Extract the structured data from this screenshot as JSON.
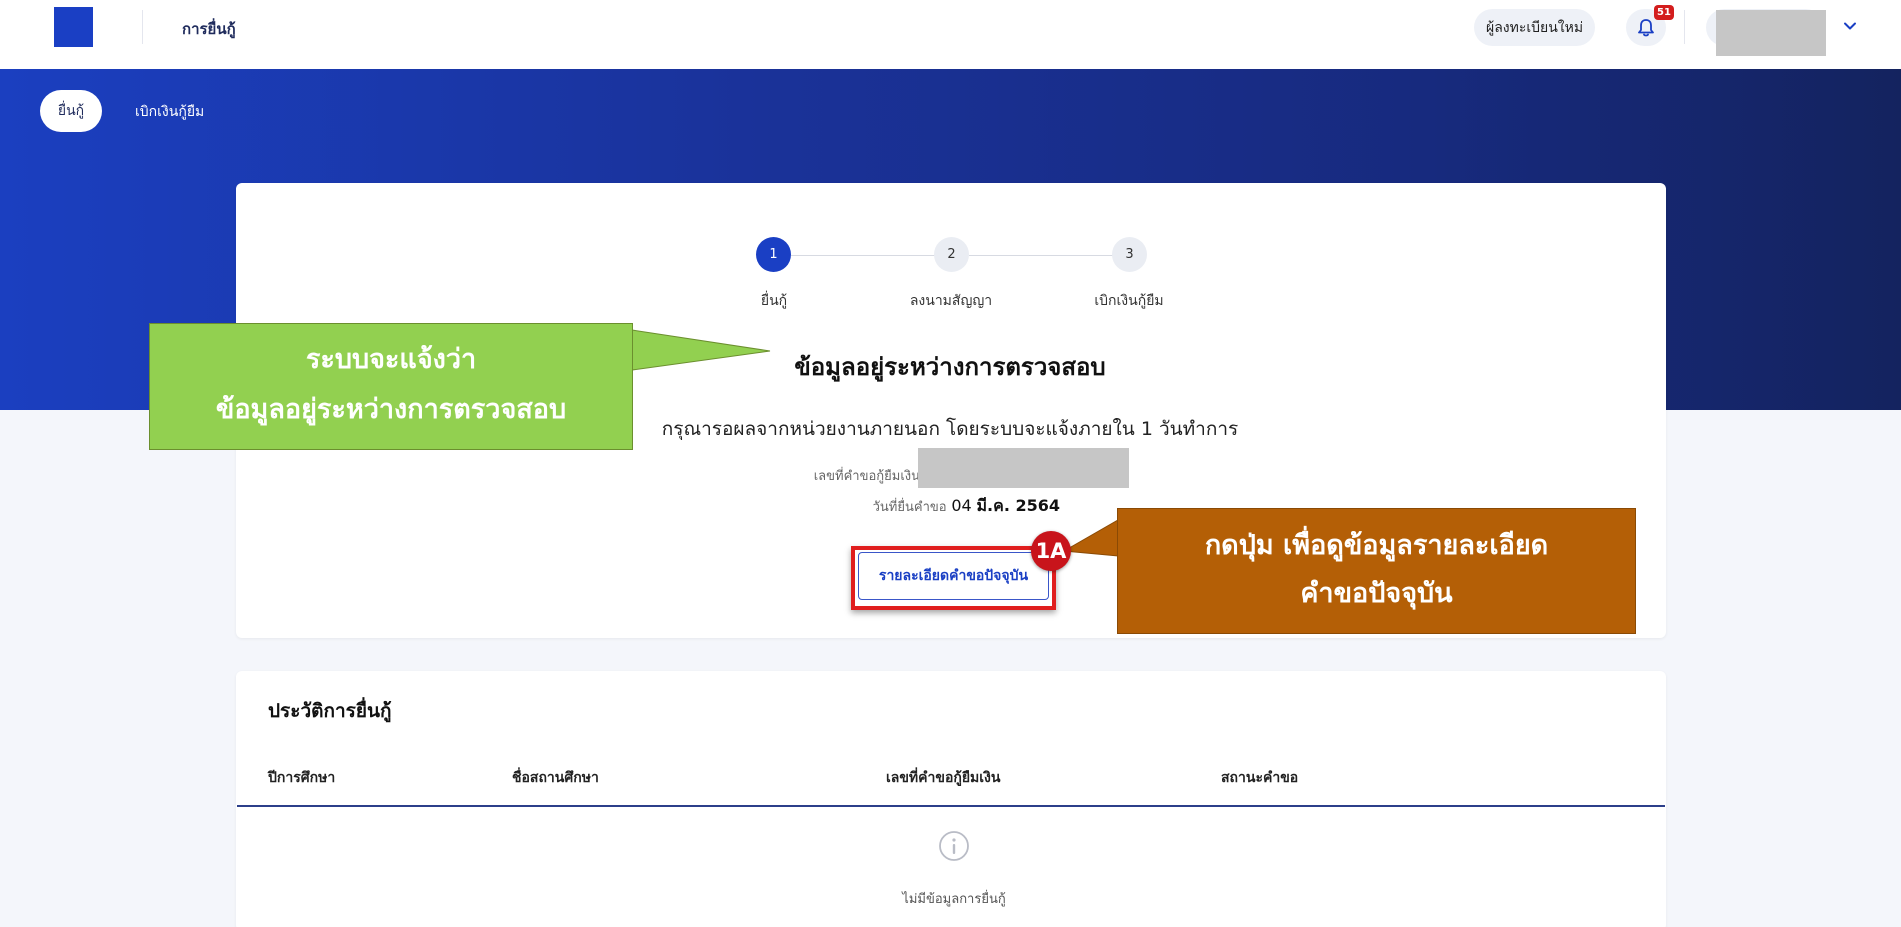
{
  "header": {
    "app_title": "การยื่นกู้",
    "register_button": "ผู้ลงทะเบียนใหม่",
    "notification_count": "51"
  },
  "nav": {
    "tabs": [
      {
        "label": "ยื่นกู้",
        "active": true
      },
      {
        "label": "เบิกเงินกู้ยืม",
        "active": false
      }
    ]
  },
  "stepper": {
    "steps": [
      {
        "number": "1",
        "label": "ยื่นกู้",
        "active": true
      },
      {
        "number": "2",
        "label": "ลงนามสัญญา",
        "active": false
      },
      {
        "number": "3",
        "label": "เบิกเงินกู้ยืม",
        "active": false
      }
    ]
  },
  "status": {
    "title": "ข้อมูลอยู่ระหว่างการตรวจสอบ",
    "description": "กรุณารอผลจากหน่วยงานภายนอก โดยระบบจะแจ้งภายใน 1 วันทำการ",
    "request_no_label": "เลขที่คำขอกู้ยืมเงิน",
    "submit_date_label": "วันที่ยื่นคำขอ",
    "submit_date_day": "04",
    "submit_date_month_year": "มี.ค. 2564",
    "detail_button": "รายละเอียดคำขอปัจจุบัน"
  },
  "annotations": {
    "green_callout_line1": "ระบบจะแจ้งว่า",
    "green_callout_line2": "ข้อมูลอยู่ระหว่างการตรวจสอบ",
    "marker": "1A",
    "orange_callout_line1": "กดปุ่ม เพื่อดูข้อมูลรายละเอียด",
    "orange_callout_line2": "คำขอปัจจุบัน",
    "green_color": "#92d050",
    "orange_color": "#b45f06",
    "highlight_color": "#e01e1e"
  },
  "history": {
    "title": "ประวัติการยื่นกู้",
    "columns": [
      "ปีการศึกษา",
      "ชื่อสถานศึกษา",
      "เลขที่คำขอกู้ยืมเงิน",
      "สถานะคำขอ"
    ],
    "empty_text": "ไม่มีข้อมูลการยื่นกู้"
  },
  "colors": {
    "primary": "#1a3fc4",
    "banner_dark": "#14235f",
    "badge_red": "#d31d1d"
  }
}
